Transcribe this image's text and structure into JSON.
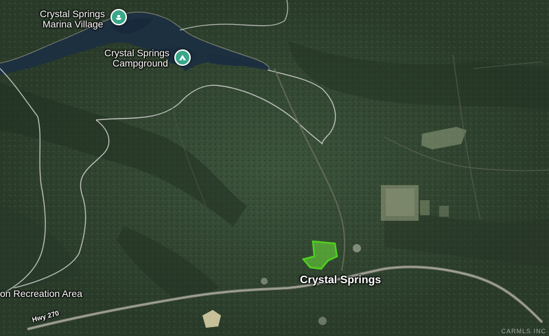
{
  "map": {
    "type": "satellite",
    "places": {
      "marina": {
        "line1": "Crystal Springs",
        "line2": "Marina Village",
        "icon": "boat-icon",
        "color": "#3aa68a"
      },
      "campground": {
        "line1": "Crystal Springs",
        "line2": "Campground",
        "icon": "campground-tent-icon",
        "color": "#3aa68a"
      },
      "town": {
        "label": "Crystal Springs"
      },
      "recreation_area": {
        "label": "on Recreation Area"
      },
      "highway": {
        "label": "Hwy 270"
      }
    },
    "parcel": {
      "color": "#6ee43a",
      "outline": "#4fd11e"
    },
    "watermark": "CARMLS INC"
  }
}
